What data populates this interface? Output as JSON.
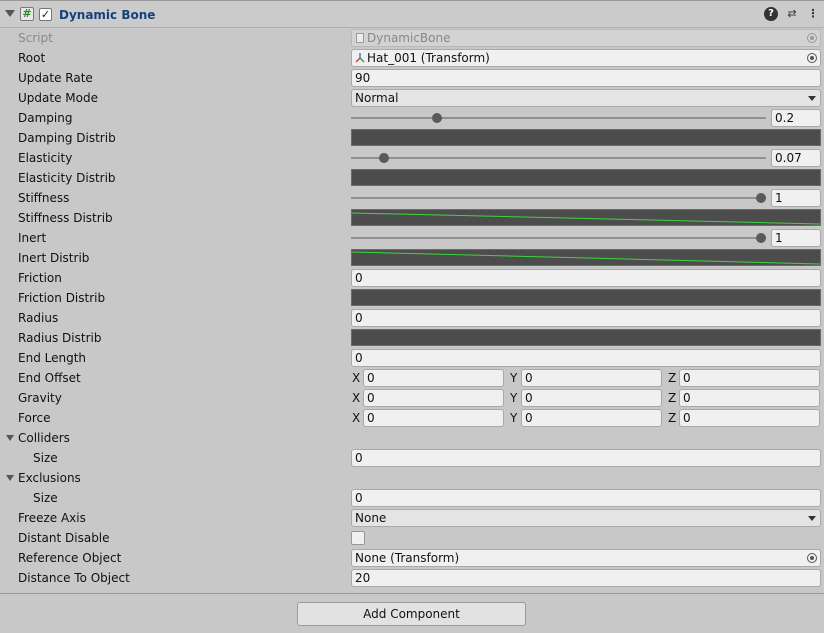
{
  "component": {
    "title": "Dynamic Bone",
    "enabled": true,
    "script_icon": "#",
    "enabled_check": "✓",
    "help_icon": "?",
    "preset_icon": "⇄",
    "menu_icon": "⋮"
  },
  "fields": {
    "script": {
      "label": "Script",
      "value": "DynamicBone"
    },
    "root": {
      "label": "Root",
      "value": "Hat_001 (Transform)"
    },
    "update_rate": {
      "label": "Update Rate",
      "value": "90"
    },
    "update_mode": {
      "label": "Update Mode",
      "value": "Normal"
    },
    "damping": {
      "label": "Damping",
      "value": "0.2",
      "fraction": 0.2
    },
    "damping_distrib": {
      "label": "Damping Distrib"
    },
    "elasticity": {
      "label": "Elasticity",
      "value": "0.07",
      "fraction": 0.07
    },
    "elasticity_distrib": {
      "label": "Elasticity Distrib"
    },
    "stiffness": {
      "label": "Stiffness",
      "value": "1",
      "fraction": 1
    },
    "stiffness_distrib": {
      "label": "Stiffness Distrib"
    },
    "inert": {
      "label": "Inert",
      "value": "1",
      "fraction": 1
    },
    "inert_distrib": {
      "label": "Inert Distrib"
    },
    "friction": {
      "label": "Friction",
      "value": "0"
    },
    "friction_distrib": {
      "label": "Friction Distrib"
    },
    "radius": {
      "label": "Radius",
      "value": "0"
    },
    "radius_distrib": {
      "label": "Radius Distrib"
    },
    "end_length": {
      "label": "End Length",
      "value": "0"
    },
    "end_offset": {
      "label": "End Offset",
      "x": "0",
      "y": "0",
      "z": "0"
    },
    "gravity": {
      "label": "Gravity",
      "x": "0",
      "y": "0",
      "z": "0"
    },
    "force": {
      "label": "Force",
      "x": "0",
      "y": "0",
      "z": "0"
    },
    "colliders": {
      "label": "Colliders",
      "size_label": "Size",
      "size": "0"
    },
    "exclusions": {
      "label": "Exclusions",
      "size_label": "Size",
      "size": "0"
    },
    "freeze_axis": {
      "label": "Freeze Axis",
      "value": "None"
    },
    "distant_disable": {
      "label": "Distant Disable",
      "checked": false
    },
    "reference_object": {
      "label": "Reference Object",
      "value": "None (Transform)"
    },
    "distance_to_object": {
      "label": "Distance To Object",
      "value": "20"
    }
  },
  "axis_labels": {
    "x": "X",
    "y": "Y",
    "z": "Z"
  },
  "add_component": "Add Component",
  "colors": {
    "curve_line": "#3fd43f",
    "curve_bg": "#4c4c4c",
    "title": "#15427c"
  }
}
